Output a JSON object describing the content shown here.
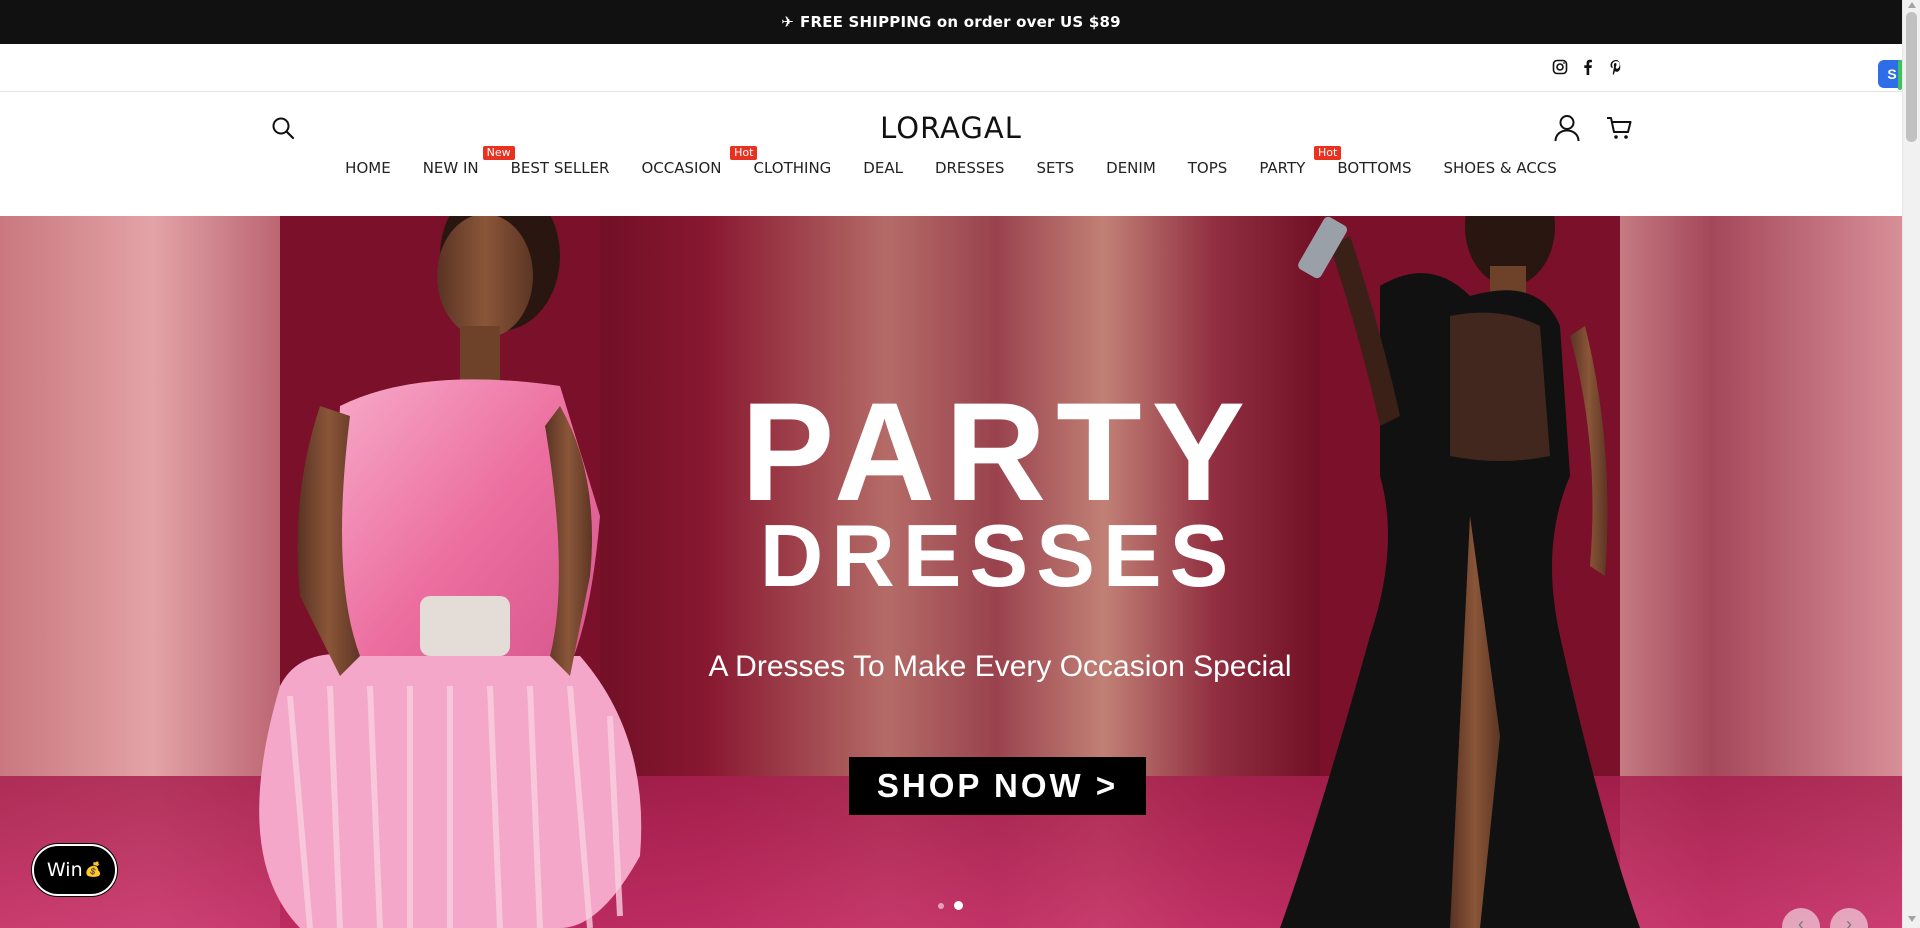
{
  "announcement": {
    "icon": "airplane-icon",
    "text": "FREE SHIPPING on order over US $89"
  },
  "social": [
    {
      "icon": "instagram-icon"
    },
    {
      "icon": "facebook-icon"
    },
    {
      "icon": "pinterest-icon"
    }
  ],
  "header": {
    "logo": "LORAGAL",
    "search_icon": "search-icon",
    "account_icon": "user-icon",
    "cart_icon": "cart-icon"
  },
  "nav": {
    "items": [
      {
        "label": "HOME",
        "badge": ""
      },
      {
        "label": "NEW IN",
        "badge": "New"
      },
      {
        "label": "BEST SELLER",
        "badge": ""
      },
      {
        "label": "OCCASION",
        "badge": "Hot"
      },
      {
        "label": "CLOTHING",
        "badge": ""
      },
      {
        "label": "DEAL",
        "badge": ""
      },
      {
        "label": "DRESSES",
        "badge": ""
      },
      {
        "label": "SETS",
        "badge": ""
      },
      {
        "label": "DENIM",
        "badge": ""
      },
      {
        "label": "TOPS",
        "badge": ""
      },
      {
        "label": "PARTY",
        "badge": "Hot"
      },
      {
        "label": "BOTTOMS",
        "badge": ""
      },
      {
        "label": "SHOES & ACCS",
        "badge": ""
      }
    ],
    "badge_color": "#e8321f"
  },
  "hero": {
    "title_line1": "PARTY",
    "title_line2": "DRESSES",
    "subtitle": "A Dresses To Make Every Occasion Special",
    "cta": "SHOP NOW >",
    "slide_count": 2,
    "active_slide": 2,
    "colors": {
      "backdrop": "#7d1229",
      "pink_dress": "#f07aa8",
      "black_gown": "#111111"
    }
  },
  "win_button": {
    "label": "Win",
    "icon": "money-bag-icon"
  },
  "carousel_controls": {
    "prev": "‹",
    "next": "›"
  }
}
